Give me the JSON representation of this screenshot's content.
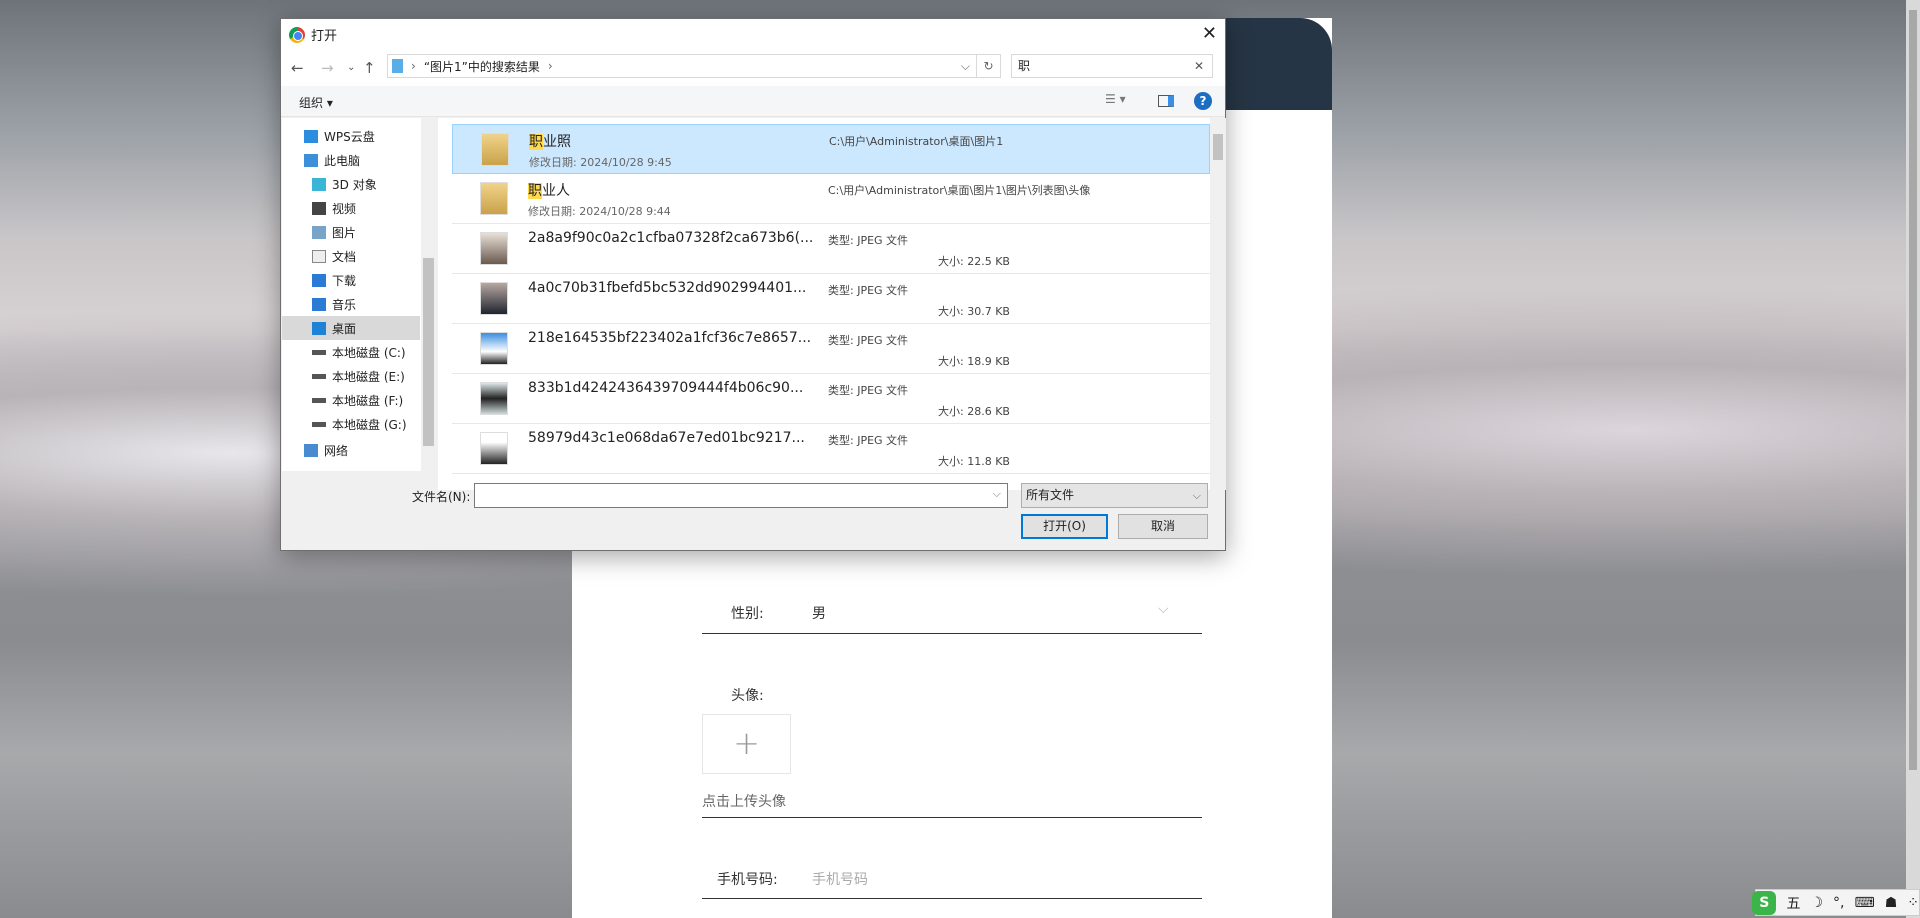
{
  "page": {
    "gender_label": "性别:",
    "gender_value": "男",
    "avatar_label": "头像:",
    "upload_plus": "+",
    "upload_hint": "点击上传头像",
    "phone_label": "手机号码:",
    "phone_placeholder": "手机号码"
  },
  "ime": {
    "logo": "S",
    "mode": "五",
    "items": [
      "☽",
      "°,",
      "⌨",
      "☗",
      "⁘"
    ]
  },
  "dialog": {
    "title": "打开",
    "close": "✕",
    "breadcrumb": "“图片1”中的搜索结果",
    "search_value": "职",
    "organize": "组织 ▾",
    "sidebar": [
      {
        "label": "WPS云盘",
        "icon": "cloud-icon"
      },
      {
        "label": "此电脑",
        "icon": "computer-icon"
      },
      {
        "label": "3D 对象",
        "icon": "cube-icon"
      },
      {
        "label": "视频",
        "icon": "video-icon"
      },
      {
        "label": "图片",
        "icon": "picture-icon"
      },
      {
        "label": "文档",
        "icon": "document-icon"
      },
      {
        "label": "下载",
        "icon": "download-icon"
      },
      {
        "label": "音乐",
        "icon": "music-icon"
      },
      {
        "label": "桌面",
        "icon": "desktop-icon",
        "selected": true
      },
      {
        "label": "本地磁盘 (C:)",
        "icon": "drive-icon"
      },
      {
        "label": "本地磁盘 (E:)",
        "icon": "drive-icon"
      },
      {
        "label": "本地磁盘 (F:)",
        "icon": "drive-icon"
      },
      {
        "label": "本地磁盘 (G:)",
        "icon": "drive-icon"
      },
      {
        "label": "网络",
        "icon": "network-icon"
      }
    ],
    "files": [
      {
        "hl": "职",
        "name": "业照",
        "sub": "修改日期: 2024/10/28 9:45",
        "col2": "C:\\用户\\Administrator\\桌面\\图片1",
        "col3": "",
        "folder": true,
        "selected": true
      },
      {
        "hl": "职",
        "name": "业人",
        "sub": "修改日期: 2024/10/28 9:44",
        "col2": "C:\\用户\\Administrator\\桌面\\图片1\\图片\\列表图\\头像",
        "col3": "",
        "folder": true
      },
      {
        "hl": "",
        "name": "2a8a9f90c0a2c1cfba07328f2ca673b6(...",
        "sub": "",
        "col2": "类型: JPEG 文件",
        "col3": "大小: 22.5 KB"
      },
      {
        "hl": "",
        "name": "4a0c70b31fbefd5bc532dd902994401...",
        "sub": "",
        "col2": "类型: JPEG 文件",
        "col3": "大小: 30.7 KB"
      },
      {
        "hl": "",
        "name": "218e164535bf223402a1fcf36c7e8657...",
        "sub": "",
        "col2": "类型: JPEG 文件",
        "col3": "大小: 18.9 KB"
      },
      {
        "hl": "",
        "name": "833b1d4242436439709444f4b06c90...",
        "sub": "",
        "col2": "类型: JPEG 文件",
        "col3": "大小: 28.6 KB"
      },
      {
        "hl": "",
        "name": "58979d43c1e068da67e7ed01bc9217...",
        "sub": "",
        "col2": "类型: JPEG 文件",
        "col3": "大小: 11.8 KB"
      }
    ],
    "filename_label": "文件名(N):",
    "filename_value": "",
    "filter": "所有文件",
    "open": "打开(O)",
    "cancel": "取消"
  }
}
